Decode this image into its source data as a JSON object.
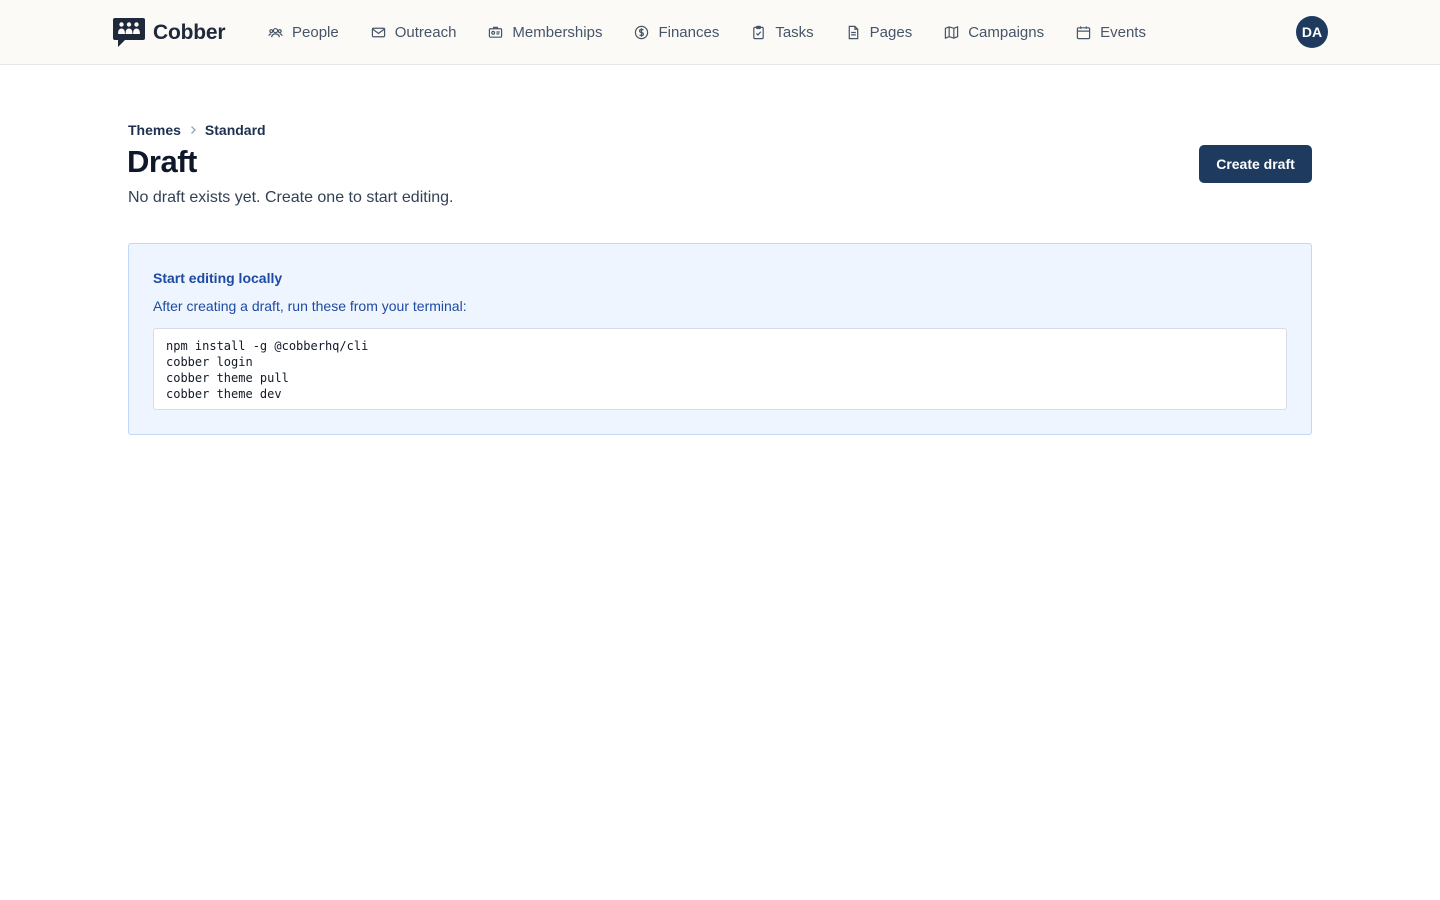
{
  "brand": {
    "name": "Cobber"
  },
  "nav": {
    "items": [
      {
        "label": "People",
        "icon": "people-icon"
      },
      {
        "label": "Outreach",
        "icon": "mail-icon"
      },
      {
        "label": "Memberships",
        "icon": "id-card-icon"
      },
      {
        "label": "Finances",
        "icon": "dollar-icon"
      },
      {
        "label": "Tasks",
        "icon": "clipboard-check-icon"
      },
      {
        "label": "Pages",
        "icon": "document-icon"
      },
      {
        "label": "Campaigns",
        "icon": "map-icon"
      },
      {
        "label": "Events",
        "icon": "calendar-icon"
      }
    ]
  },
  "user": {
    "initials": "DA"
  },
  "breadcrumb": {
    "items": [
      "Themes",
      "Standard"
    ]
  },
  "page": {
    "title": "Draft",
    "subtitle": "No draft exists yet. Create one to start editing.",
    "create_button": "Create draft"
  },
  "info": {
    "title": "Start editing locally",
    "description": "After creating a draft, run these from your terminal:",
    "commands": [
      "npm install -g @cobberhq/cli",
      "cobber login",
      "cobber theme pull",
      "cobber theme dev"
    ]
  },
  "colors": {
    "primary": "#1e3a5f",
    "info_text": "#1d4aa3",
    "info_bg": "#eef5fe",
    "info_border": "#bfd8f6",
    "topbar_bg": "#fbfaf6"
  }
}
